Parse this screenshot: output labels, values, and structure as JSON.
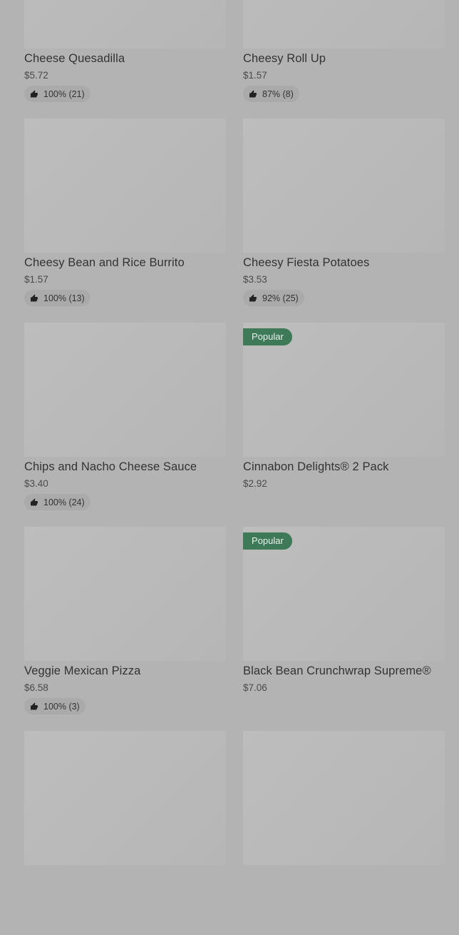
{
  "items": [
    {
      "name": "Cheese Quesadilla",
      "price": "$5.72",
      "rating": "100% (21)",
      "badge": ""
    },
    {
      "name": "Cheesy Roll Up",
      "price": "$1.57",
      "rating": "87% (8)",
      "badge": ""
    },
    {
      "name": "Cheesy Bean and Rice Burrito",
      "price": "$1.57",
      "rating": "100% (13)",
      "badge": ""
    },
    {
      "name": "Cheesy Fiesta Potatoes",
      "price": "$3.53",
      "rating": "92% (25)",
      "badge": ""
    },
    {
      "name": "Chips and Nacho Cheese Sauce",
      "price": "$3.40",
      "rating": "100% (24)",
      "badge": ""
    },
    {
      "name": "Cinnabon Delights® 2 Pack",
      "price": "$2.92",
      "rating": "",
      "badge": "Popular"
    },
    {
      "name": "Veggie Mexican Pizza",
      "price": "$6.58",
      "rating": "100% (3)",
      "badge": ""
    },
    {
      "name": "Black Bean Crunchwrap Supreme®",
      "price": "$7.06",
      "rating": "",
      "badge": "Popular"
    },
    {
      "name": "",
      "price": "",
      "rating": "",
      "badge": ""
    },
    {
      "name": "",
      "price": "",
      "rating": "",
      "badge": ""
    }
  ],
  "icons": {
    "rating": "thumbs-up-icon"
  },
  "colors": {
    "badge": "#3e7a58",
    "overlay": "#b3b3b3"
  }
}
